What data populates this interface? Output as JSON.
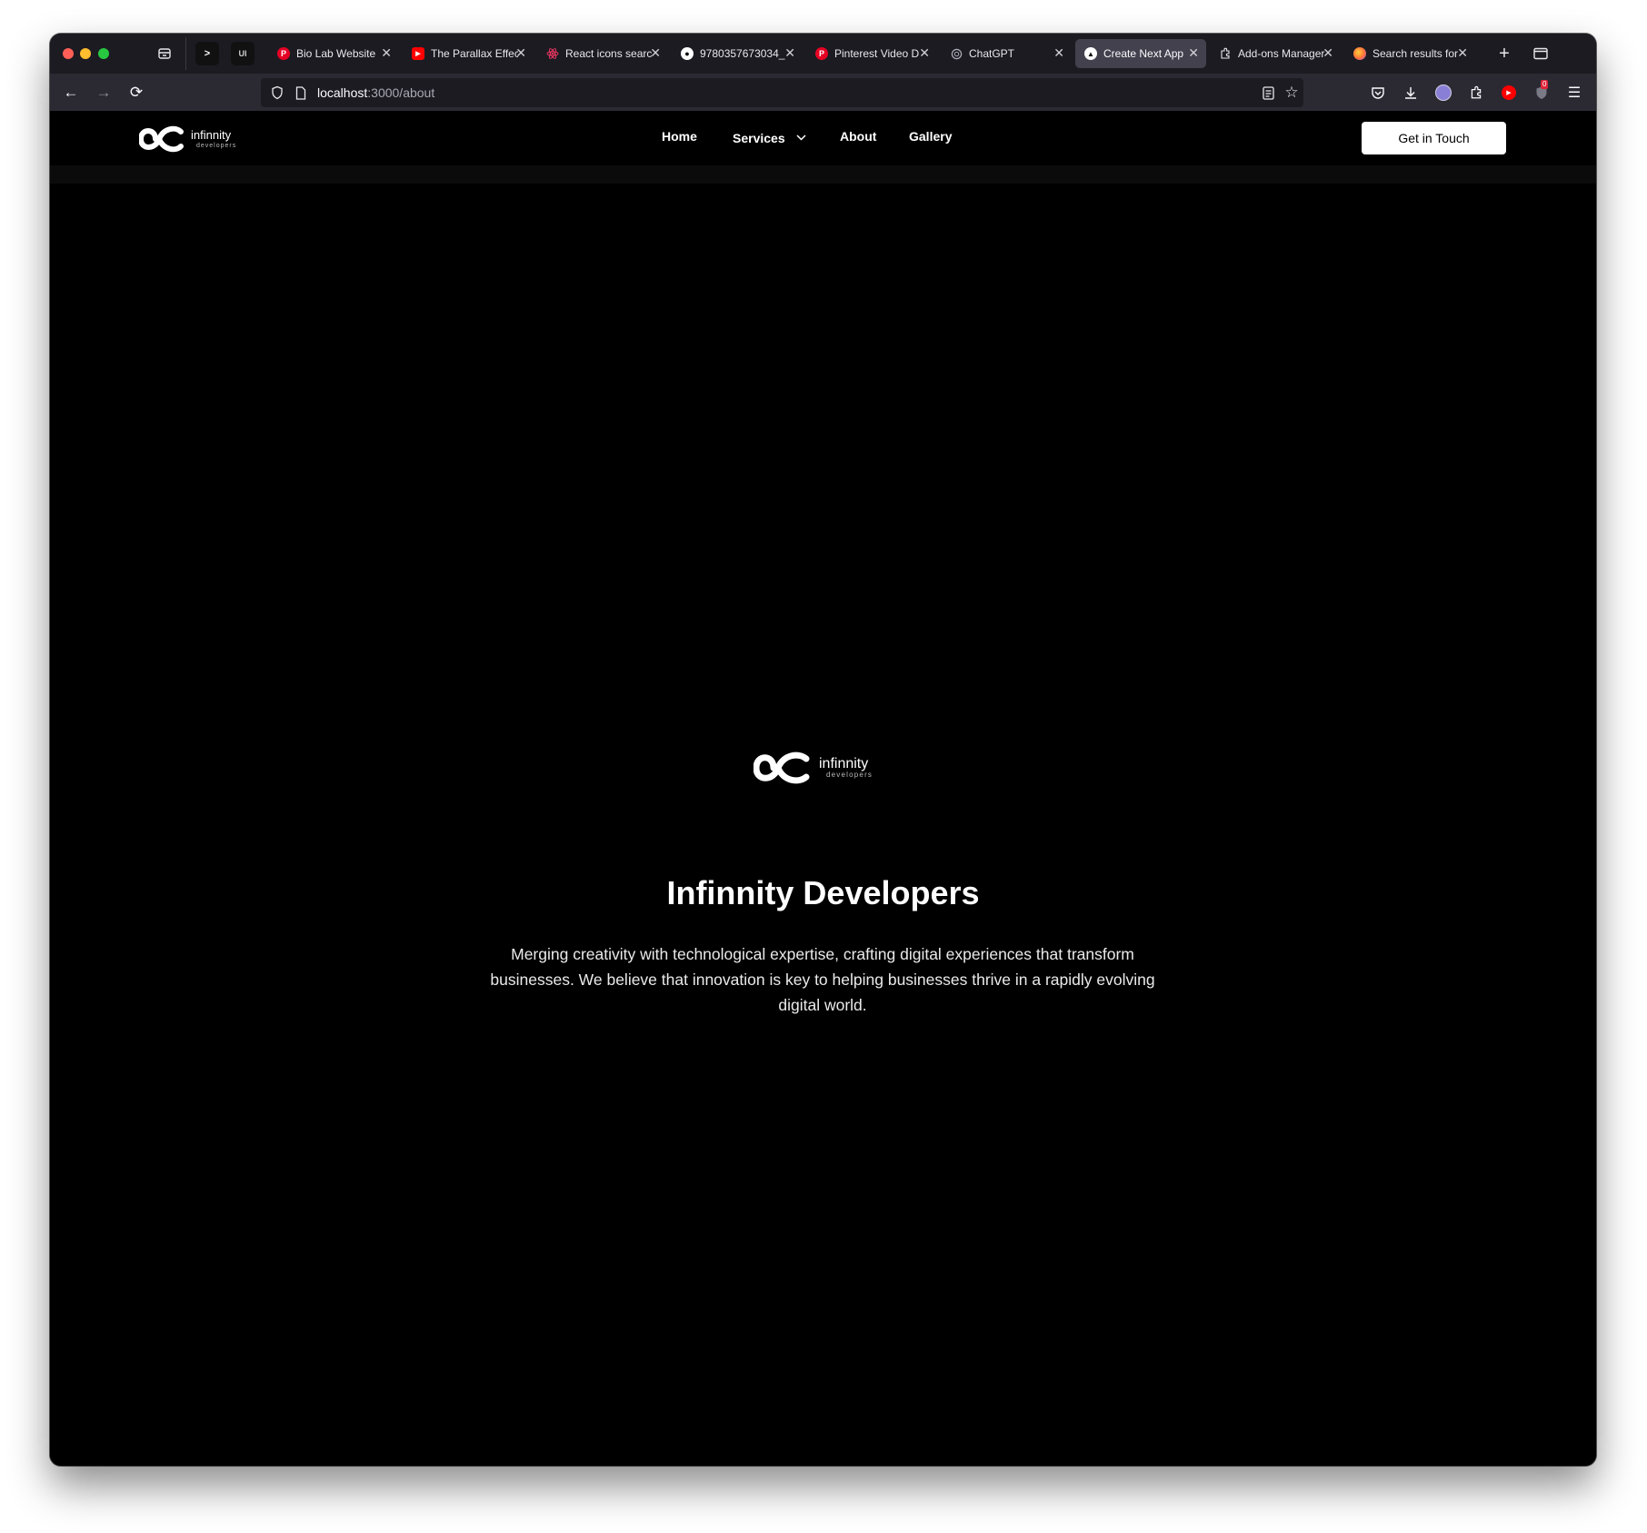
{
  "browser": {
    "pinned": [
      {
        "label": ">",
        "icon": "terminal-icon"
      },
      {
        "label": "UI",
        "icon": "ui-icon"
      }
    ],
    "tabs": [
      {
        "title": "Bio Lab Website",
        "icon": "pinterest-icon",
        "color": "#e60023",
        "active": false
      },
      {
        "title": "The Parallax Effect",
        "icon": "youtube-icon",
        "color": "#ff0000",
        "active": false
      },
      {
        "title": "React icons search",
        "icon": "react-icon",
        "color": "#e2365f",
        "active": false
      },
      {
        "title": "9780357673034_",
        "icon": "github-icon",
        "color": "#ffffff",
        "active": false
      },
      {
        "title": "Pinterest Video D",
        "icon": "pinterest-icon",
        "color": "#e60023",
        "active": false
      },
      {
        "title": "ChatGPT",
        "icon": "chatgpt-icon",
        "color": "#8e8ea0",
        "active": false
      },
      {
        "title": "Create Next App",
        "icon": "nextjs-icon",
        "color": "#000000",
        "active": true
      },
      {
        "title": "Add-ons Manager",
        "icon": "puzzle-icon",
        "color": "#e8e8ea",
        "active": false
      },
      {
        "title": "Search results for",
        "icon": "firefox-icon",
        "color": "#ff7139",
        "active": false
      }
    ],
    "url": {
      "host": "localhost",
      "path": ":3000/about"
    },
    "badge": "0"
  },
  "site": {
    "logo": {
      "word": "infinnity",
      "sub": "developers"
    },
    "menu": [
      "Home",
      "Services",
      "About",
      "Gallery"
    ],
    "cta": "Get in Touch",
    "hero": {
      "title": "Infinnity Developers",
      "description": "Merging creativity with technological expertise, crafting digital experiences that transform businesses. We believe that innovation is key to helping businesses thrive in a rapidly evolving digital world."
    }
  }
}
